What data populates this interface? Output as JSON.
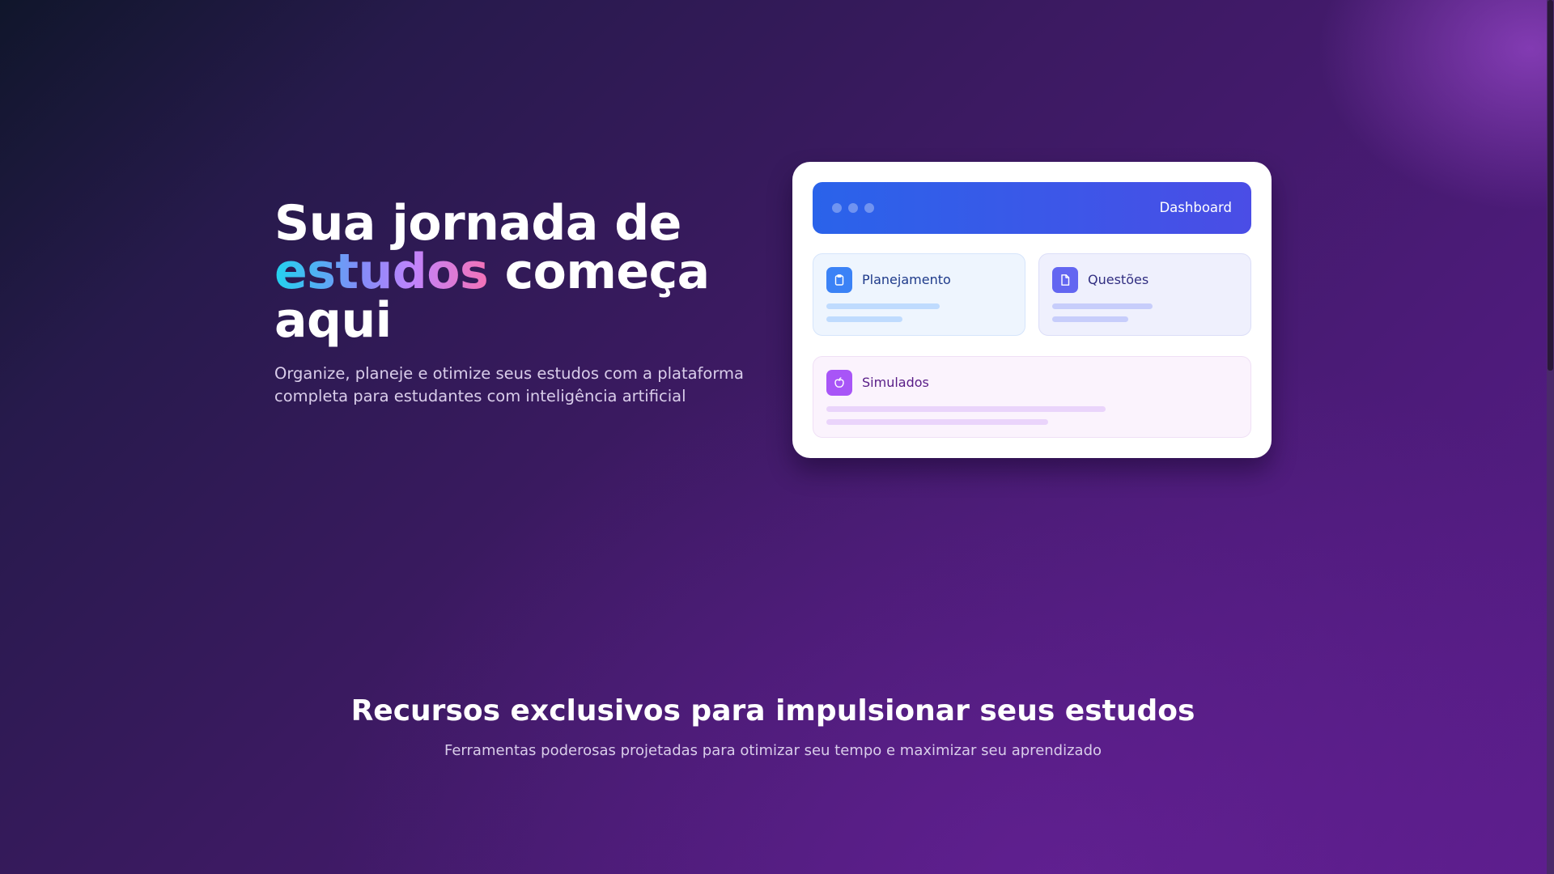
{
  "hero": {
    "title_line1": "Sua jornada de",
    "title_highlight": "estudos",
    "title_line2_rest": " começa",
    "title_line3": "aqui",
    "subtitle": "Organize, planeje e otimize seus estudos com a plataforma completa para estudantes com inteligência artificial"
  },
  "dashboard": {
    "title": "Dashboard",
    "tiles": [
      {
        "label": "Planejamento",
        "icon": "clipboard-icon",
        "progress": [
          0.61,
          0.41
        ],
        "color": "#3b82f6"
      },
      {
        "label": "Questões",
        "icon": "document-icon",
        "progress": [
          0.54,
          0.41
        ],
        "color": "#6366f1"
      },
      {
        "label": "Simulados",
        "icon": "apple-icon",
        "progress": [
          0.68,
          0.54
        ],
        "color": "#a855f7"
      }
    ]
  },
  "features": {
    "title": "Recursos exclusivos para impulsionar seus estudos",
    "subtitle": "Ferramentas poderosas projetadas para otimizar seu tempo e maximizar seu aprendizado"
  },
  "colors": {
    "header_gradient_start": "#2a63ea",
    "header_gradient_end": "#4a4de6",
    "background_dark": "#10162b",
    "background_purple": "#5a1d8a"
  }
}
